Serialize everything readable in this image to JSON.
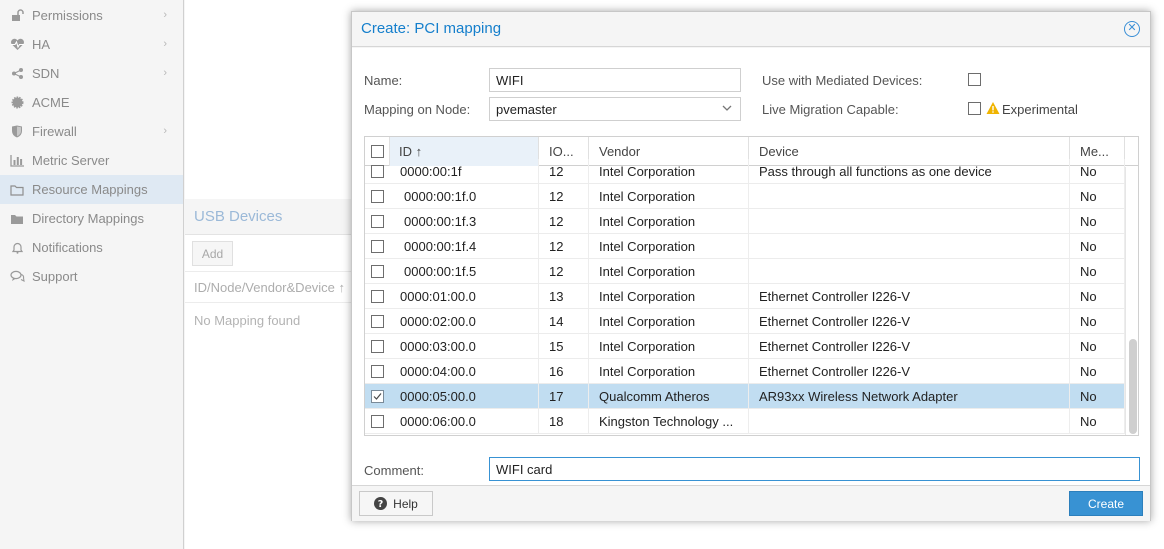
{
  "sidebar": {
    "items": [
      {
        "label": "Permissions",
        "icon": "unlock-icon",
        "chevron": true
      },
      {
        "label": "HA",
        "icon": "heartbeat-icon",
        "chevron": true
      },
      {
        "label": "SDN",
        "icon": "sdn-icon",
        "chevron": true
      },
      {
        "label": "ACME",
        "icon": "certificate-icon",
        "chevron": false
      },
      {
        "label": "Firewall",
        "icon": "shield-icon",
        "chevron": true
      },
      {
        "label": "Metric Server",
        "icon": "bar-chart-icon",
        "chevron": false
      },
      {
        "label": "Resource Mappings",
        "icon": "folder-icon",
        "chevron": false,
        "selected": true
      },
      {
        "label": "Directory Mappings",
        "icon": "folder-icon",
        "chevron": false
      },
      {
        "label": "Notifications",
        "icon": "bell-icon",
        "chevron": false
      },
      {
        "label": "Support",
        "icon": "comments-icon",
        "chevron": false
      }
    ]
  },
  "background": {
    "usb_title": "USB Devices",
    "add_label": "Add",
    "col_header": "ID/Node/Vendor&Device ↑",
    "empty_text": "No Mapping found"
  },
  "dialog": {
    "title": "Create: PCI mapping",
    "name_label": "Name:",
    "name_value": "WIFI",
    "node_label": "Mapping on Node:",
    "node_value": "pvemaster",
    "mdev_label": "Use with Mediated Devices:",
    "live_label": "Live Migration Capable:",
    "experimental_label": "Experimental",
    "columns": [
      "ID ↑",
      "IO...",
      "Vendor",
      "Device",
      "Me..."
    ],
    "rows": [
      {
        "id": "0000:00:1f",
        "io": "12",
        "vendor": "Intel Corporation",
        "device": "Pass through all functions as one device",
        "me": "No",
        "checked": false,
        "indent": false
      },
      {
        "id": "0000:00:1f.0",
        "io": "12",
        "vendor": "Intel Corporation",
        "device": "",
        "me": "No",
        "checked": false,
        "indent": true
      },
      {
        "id": "0000:00:1f.3",
        "io": "12",
        "vendor": "Intel Corporation",
        "device": "",
        "me": "No",
        "checked": false,
        "indent": true
      },
      {
        "id": "0000:00:1f.4",
        "io": "12",
        "vendor": "Intel Corporation",
        "device": "",
        "me": "No",
        "checked": false,
        "indent": true
      },
      {
        "id": "0000:00:1f.5",
        "io": "12",
        "vendor": "Intel Corporation",
        "device": "",
        "me": "No",
        "checked": false,
        "indent": true
      },
      {
        "id": "0000:01:00.0",
        "io": "13",
        "vendor": "Intel Corporation",
        "device": "Ethernet Controller I226-V",
        "me": "No",
        "checked": false,
        "indent": false
      },
      {
        "id": "0000:02:00.0",
        "io": "14",
        "vendor": "Intel Corporation",
        "device": "Ethernet Controller I226-V",
        "me": "No",
        "checked": false,
        "indent": false
      },
      {
        "id": "0000:03:00.0",
        "io": "15",
        "vendor": "Intel Corporation",
        "device": "Ethernet Controller I226-V",
        "me": "No",
        "checked": false,
        "indent": false
      },
      {
        "id": "0000:04:00.0",
        "io": "16",
        "vendor": "Intel Corporation",
        "device": "Ethernet Controller I226-V",
        "me": "No",
        "checked": false,
        "indent": false
      },
      {
        "id": "0000:05:00.0",
        "io": "17",
        "vendor": "Qualcomm Atheros",
        "device": "AR93xx Wireless Network Adapter",
        "me": "No",
        "checked": true,
        "indent": false
      },
      {
        "id": "0000:06:00.0",
        "io": "18",
        "vendor": "Kingston Technology ...",
        "device": "",
        "me": "No",
        "checked": false,
        "indent": false
      }
    ],
    "comment_label": "Comment:",
    "comment_value": "WIFI card",
    "help_label": "Help",
    "create_label": "Create"
  },
  "colors": {
    "accent": "#157fcc",
    "selected_row": "#c1ddf1",
    "create_button": "#3892d3"
  }
}
